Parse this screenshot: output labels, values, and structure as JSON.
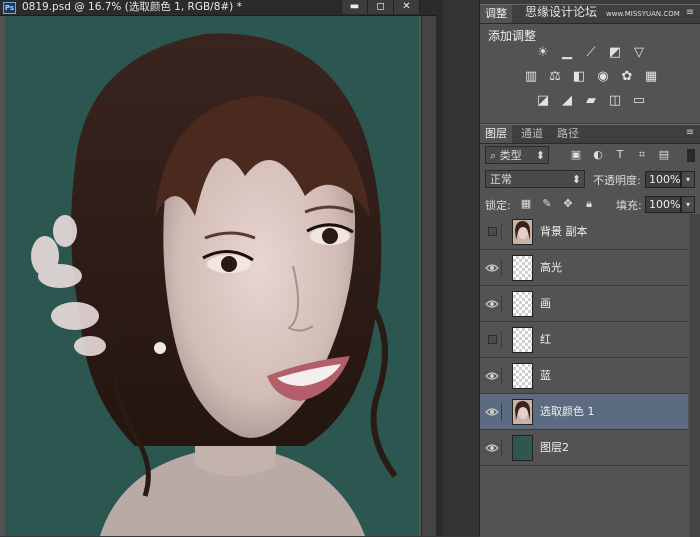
{
  "document": {
    "title": "0819.psd @ 16.7% (选取颜色 1, RGB/8#) *",
    "app_badge": "Ps",
    "window_controls": [
      "minimize",
      "maximize",
      "close"
    ]
  },
  "watermark": {
    "text": "思缘设计论坛",
    "url": "www.MISSYUAN.COM"
  },
  "adjustments_panel": {
    "tab": "调整",
    "heading": "添加调整",
    "icon_rows": [
      [
        "brightness-contrast-icon",
        "levels-icon",
        "curves-icon",
        "exposure-icon",
        "vibrance-icon"
      ],
      [
        "hue-saturation-icon",
        "color-balance-icon",
        "black-white-icon",
        "photo-filter-icon",
        "channel-mixer-icon",
        "color-lookup-icon"
      ],
      [
        "invert-icon",
        "posterize-icon",
        "threshold-icon",
        "selective-color-icon",
        "gradient-map-icon"
      ]
    ]
  },
  "layers_panel": {
    "tabs": [
      "图层",
      "通道",
      "路径"
    ],
    "filter_kind": "类型",
    "filter_icons": [
      "pixel-filter-icon",
      "adjustment-filter-icon",
      "type-filter-icon",
      "shape-filter-icon",
      "smart-object-filter-icon"
    ],
    "blend_mode": "正常",
    "opacity_label": "不透明度:",
    "opacity_value": "100%",
    "lock_label": "锁定:",
    "fill_label": "填充:",
    "fill_value": "100%",
    "layers": [
      {
        "name": "背景 副本",
        "visible": false,
        "thumb": "photo",
        "selected": false
      },
      {
        "name": "高光",
        "visible": true,
        "thumb": "checker",
        "selected": false
      },
      {
        "name": "画",
        "visible": true,
        "thumb": "checker",
        "selected": false
      },
      {
        "name": "红",
        "visible": false,
        "thumb": "checker",
        "selected": false
      },
      {
        "name": "蓝",
        "visible": true,
        "thumb": "checker",
        "selected": false
      },
      {
        "name": "选取颜色 1",
        "visible": true,
        "thumb": "photo",
        "selected": true
      },
      {
        "name": "图层2",
        "visible": true,
        "thumb": "fill",
        "selected": false
      }
    ]
  },
  "colors": {
    "canvas_background": "#2b5750",
    "layer2_fill": "#2f574f",
    "selected_row": "#5d6b80",
    "panel_bg": "#535353"
  }
}
